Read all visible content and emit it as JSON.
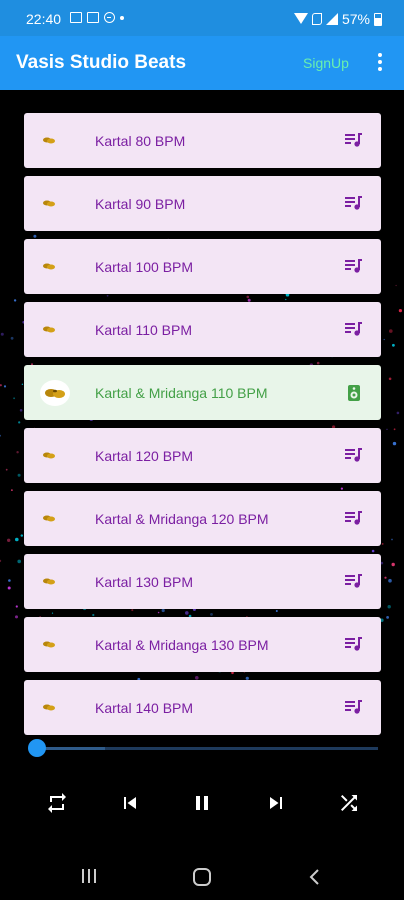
{
  "status_bar": {
    "time": "22:40",
    "battery": "57%",
    "icons": [
      "gallery-icon",
      "card-icon",
      "dnd-icon",
      "dot-icon",
      "wifi-icon",
      "call-icon",
      "signal-icon",
      "battery-icon"
    ]
  },
  "app_bar": {
    "title": "Vasis Studio Beats",
    "signup_label": "SignUp",
    "menu_icon": "more-vert-icon",
    "color": "#2196f3",
    "signup_color": "#69f0ae"
  },
  "tracks": [
    {
      "label": "Kartal 80 BPM",
      "action_icon": "playlist-icon",
      "active": false
    },
    {
      "label": "Kartal 90 BPM",
      "action_icon": "playlist-icon",
      "active": false
    },
    {
      "label": "Kartal 100 BPM",
      "action_icon": "playlist-icon",
      "active": false
    },
    {
      "label": "Kartal 110 BPM",
      "action_icon": "playlist-icon",
      "active": false
    },
    {
      "label": "Kartal & Mridanga 110 BPM",
      "action_icon": "speaker-icon",
      "active": true
    },
    {
      "label": "Kartal 120 BPM",
      "action_icon": "playlist-icon",
      "active": false
    },
    {
      "label": "Kartal & Mridanga 120 BPM",
      "action_icon": "playlist-icon",
      "active": false
    },
    {
      "label": "Kartal 130 BPM",
      "action_icon": "playlist-icon",
      "active": false
    },
    {
      "label": "Kartal & Mridanga 130 BPM",
      "action_icon": "playlist-icon",
      "active": false
    },
    {
      "label": "Kartal 140 BPM",
      "action_icon": "playlist-icon",
      "active": false
    }
  ],
  "colors": {
    "track_bg": "#f3e5f5",
    "track_active_bg": "#e8f5e9",
    "track_text": "#7b1fa2",
    "track_active_text": "#43a047"
  },
  "player": {
    "progress_fraction": 0.0,
    "controls": [
      "repeat-icon",
      "skip-previous-icon",
      "pause-icon",
      "skip-next-icon",
      "shuffle-icon"
    ]
  },
  "nav_bar": {
    "buttons": [
      "recents-icon",
      "home-icon",
      "back-icon"
    ]
  }
}
